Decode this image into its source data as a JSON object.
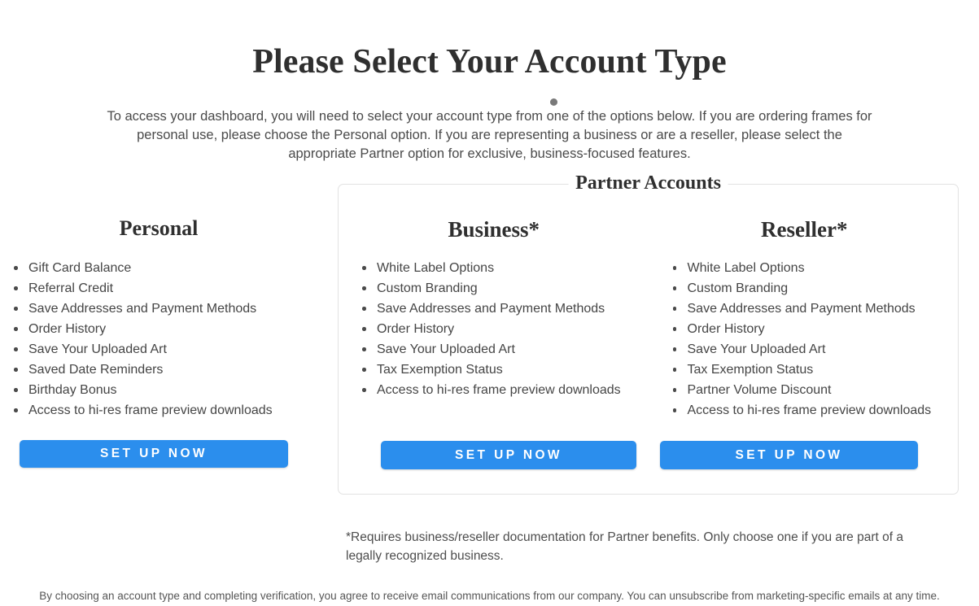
{
  "page": {
    "title": "Please Select Your Account Type",
    "intro": "To access your dashboard, you will need to select your account type from one of the options below. If you are ordering frames for personal use, please choose the Personal option. If you are representing a business or are a reseller, please select the appropriate Partner option for exclusive, business-focused features.",
    "footnote": "*Requires business/reseller documentation for Partner benefits. Only choose one if you are part of a legally recognized business.",
    "disclaimer": "By choosing an account type and completing verification, you agree to receive email communications from our company. You can unsubscribe from marketing-specific emails at any time."
  },
  "colors": {
    "accent": "#2b8eed",
    "heading": "#2f2f2f",
    "body_text": "#454545",
    "border": "#e2e2e2",
    "background": "#ffffff"
  },
  "personal": {
    "heading": "Personal",
    "cta_label": "SET UP NOW",
    "features": [
      "Gift Card Balance",
      "Referral Credit",
      "Save Addresses and Payment Methods",
      "Order History",
      "Save Your Uploaded Art",
      "Saved Date Reminders",
      "Birthday Bonus",
      "Access to hi-res frame preview downloads"
    ]
  },
  "partner": {
    "legend": "Partner Accounts",
    "columns": [
      {
        "heading": "Business*",
        "cta_label": "SET UP NOW",
        "features": [
          "White Label Options",
          "Custom Branding",
          "Save Addresses and Payment Methods",
          "Order History",
          "Save Your Uploaded Art",
          "Tax Exemption Status",
          "Access to hi-res frame preview downloads"
        ]
      },
      {
        "heading": "Reseller*",
        "cta_label": "SET UP NOW",
        "features": [
          "White Label Options",
          "Custom Branding",
          "Save Addresses and Payment Methods",
          "Order History",
          "Save Your Uploaded Art",
          "Tax Exemption Status",
          "Partner Volume Discount",
          "Access to hi-res frame preview downloads"
        ]
      }
    ]
  }
}
